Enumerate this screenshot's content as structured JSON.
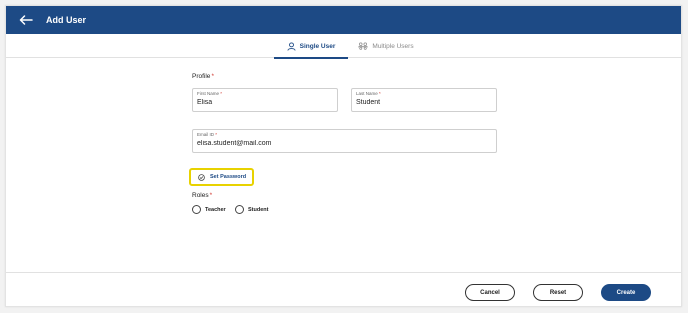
{
  "header": {
    "title": "Add User"
  },
  "tabs": [
    {
      "label": "Single User",
      "icon": "user-icon",
      "active": true
    },
    {
      "label": "Multiple Users",
      "icon": "users-icon",
      "active": false
    }
  ],
  "profile": {
    "section_label": "Profile",
    "required_mark": "*",
    "first_name": {
      "label": "First Name",
      "value": "Elisa"
    },
    "last_name": {
      "label": "Last Name",
      "value": "Student"
    },
    "email": {
      "label": "Email ID",
      "value": "elisa.student@mail.com"
    }
  },
  "set_password": {
    "label": "Set Password",
    "icon": "check-circle-icon"
  },
  "roles": {
    "section_label": "Roles",
    "required_mark": "*",
    "options": [
      "Teacher",
      "Student"
    ]
  },
  "footer": {
    "cancel_label": "Cancel",
    "reset_label": "Reset",
    "create_label": "Create"
  },
  "colors": {
    "primary": "#1d4a85",
    "required": "#d0342c",
    "highlight": "#e8d200"
  }
}
